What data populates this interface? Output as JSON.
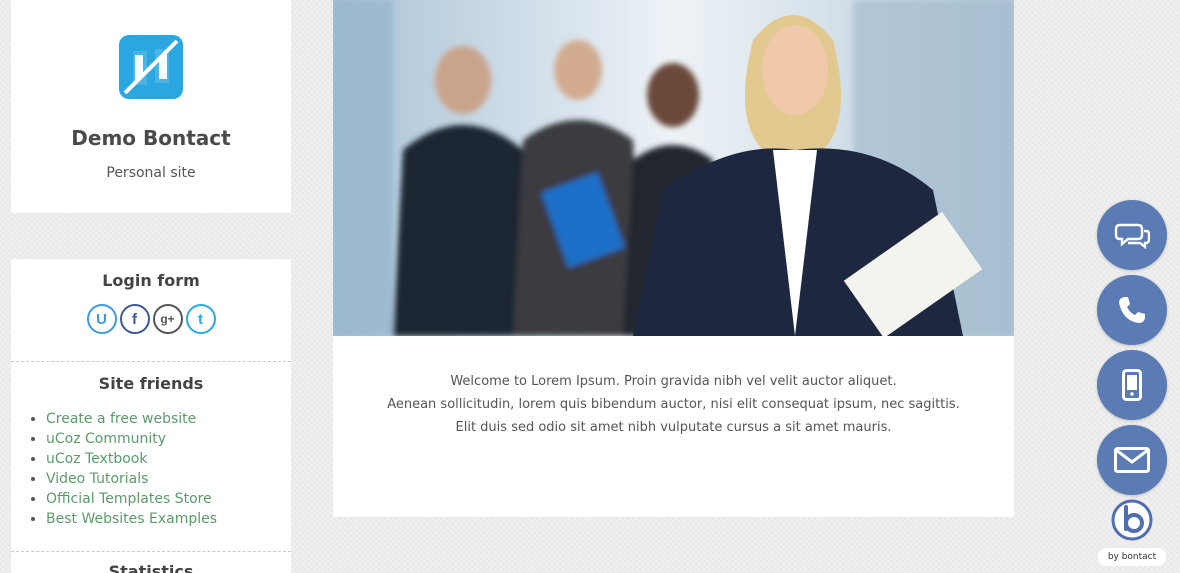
{
  "brand": {
    "title": "Demo Bontact",
    "subtitle": "Personal site"
  },
  "login": {
    "title": "Login form",
    "social": [
      {
        "name": "ucoz",
        "glyph": "U"
      },
      {
        "name": "facebook",
        "glyph": "f"
      },
      {
        "name": "googleplus",
        "glyph": "g+"
      },
      {
        "name": "twitter",
        "glyph": "t"
      }
    ]
  },
  "friends": {
    "title": "Site friends",
    "items": [
      "Create a free website",
      "uCoz Community",
      "uCoz Textbook",
      "Video Tutorials",
      "Official Templates Store",
      "Best Websites Examples"
    ]
  },
  "stats": {
    "title": "Statistics"
  },
  "main": {
    "welcome_lines": [
      "Welcome to Lorem Ipsum. Proin gravida nibh vel velit auctor aliquet.",
      "Aenean sollicitudin, lorem quis bibendum auctor, nisi elit consequat ipsum, nec sagittis.",
      "Elit duis sed odio sit amet nibh vulputate cursus a sit amet mauris."
    ]
  },
  "widget": {
    "label": "by bontact"
  },
  "colors": {
    "accent_blue": "#5a7bb3",
    "link_green": "#5b9a6a",
    "logo_blue": "#2aa7e0"
  }
}
